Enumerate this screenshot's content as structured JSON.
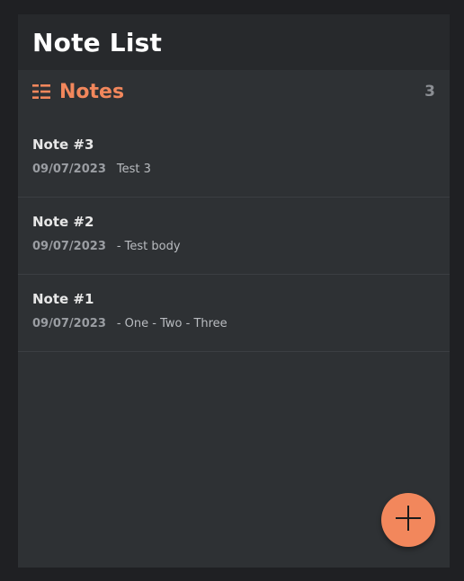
{
  "header": {
    "title": "Note List"
  },
  "section": {
    "label": "Notes",
    "count": "3",
    "icon": "list-icon"
  },
  "notes": [
    {
      "title": "Note #3",
      "date": "09/07/2023",
      "body": "Test 3"
    },
    {
      "title": "Note #2",
      "date": "09/07/2023",
      "body": "- Test body"
    },
    {
      "title": "Note #1",
      "date": "09/07/2023",
      "body": "- One - Two - Three"
    }
  ],
  "fab": {
    "icon": "plus-icon"
  },
  "colors": {
    "accent": "#f2875c",
    "panel": "#2e3134",
    "header": "#27292c",
    "background": "#1f2023"
  }
}
